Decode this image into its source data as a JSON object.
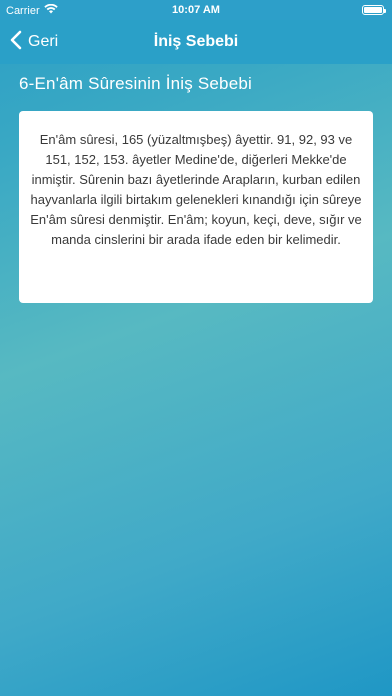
{
  "status_bar": {
    "carrier": "Carrier",
    "time": "10:07 AM",
    "icons": [
      "wifi-icon",
      "battery-icon"
    ]
  },
  "nav_bar": {
    "back_label": "Geri",
    "title": "İniş Sebebi",
    "back_icon": "chevron-left-icon"
  },
  "main": {
    "section_title": "6-En'âm Sûresinin İniş Sebebi",
    "content": "En'âm sûresi, 165 (yüzaltmışbeş) âyettir. 91, 92, 93 ve 151, 152, 153. âyetler Medine'de, diğerleri Mekke'de inmiştir. Sûrenin bazı âyetlerinde Arapların, kurban edilen hayvanlarla ilgili birtakım gelenekleri kınandığı için sûreye En'âm sûresi denmiştir. En'âm; koyun, keçi, deve, sığır ve manda cinslerini bir arada ifade eden bir kelimedir."
  },
  "colors": {
    "nav_background": "#2aa0c8",
    "card_background": "#ffffff",
    "text": "#3a3a3a"
  }
}
